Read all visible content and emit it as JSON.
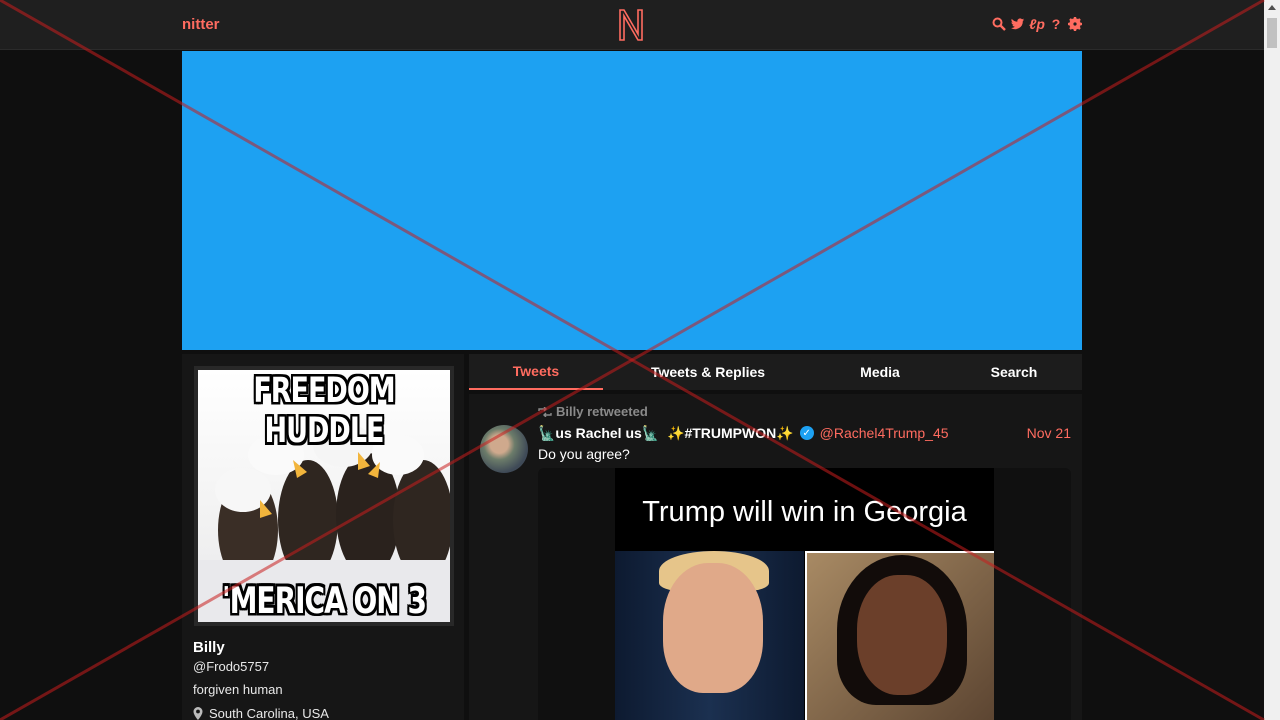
{
  "navbar": {
    "brand": "nitter",
    "logo_letter": "N",
    "icons": [
      "search-icon",
      "twitter-icon",
      "rss-icon",
      "help-icon",
      "gear-icon"
    ],
    "icon_glyphs": [
      "⌕",
      "🐦",
      "ℓ",
      "?",
      "⚙"
    ]
  },
  "banner": {
    "color": "#1da1f2"
  },
  "profile": {
    "meme_top": "FREEDOM HUDDLE",
    "meme_bottom": "'MERICA ON 3",
    "name": "Billy",
    "handle": "@Frodo5757",
    "bio": "forgiven human",
    "location": "South Carolina, USA"
  },
  "tabs": [
    {
      "label": "Tweets",
      "active": true
    },
    {
      "label": "Tweets & Replies",
      "active": false
    },
    {
      "label": "Media",
      "active": false
    },
    {
      "label": "Search",
      "active": false
    }
  ],
  "tweet": {
    "retweet_label": "Billy retweeted",
    "fullname": "🗽us Rachel us🗽  ✨#TRUMPWON✨",
    "username": "@Rachel4Trump_45",
    "date": "Nov 21",
    "text": "Do you agree?",
    "media_caption": "Trump will win in Georgia"
  },
  "colors": {
    "accent": "#ff6c60",
    "background": "#0f0f0f",
    "panel": "#161616",
    "verified": "#1da1f2"
  }
}
